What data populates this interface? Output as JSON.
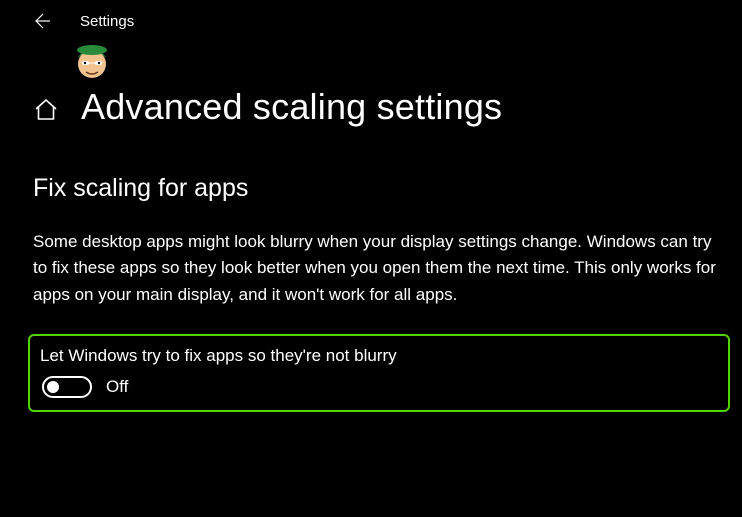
{
  "titlebar": {
    "app_name": "Settings"
  },
  "header": {
    "page_title": "Advanced scaling settings"
  },
  "section": {
    "title": "Fix scaling for apps",
    "description": "Some desktop apps might look blurry when your display settings change. Windows can try to fix these apps so they look better when you open them the next time. This only works for apps on your main display, and it won't work for all apps."
  },
  "setting": {
    "label": "Let Windows try to fix apps so they're not blurry",
    "state_label": "Off",
    "enabled": false
  },
  "colors": {
    "highlight_border": "#52d400"
  }
}
